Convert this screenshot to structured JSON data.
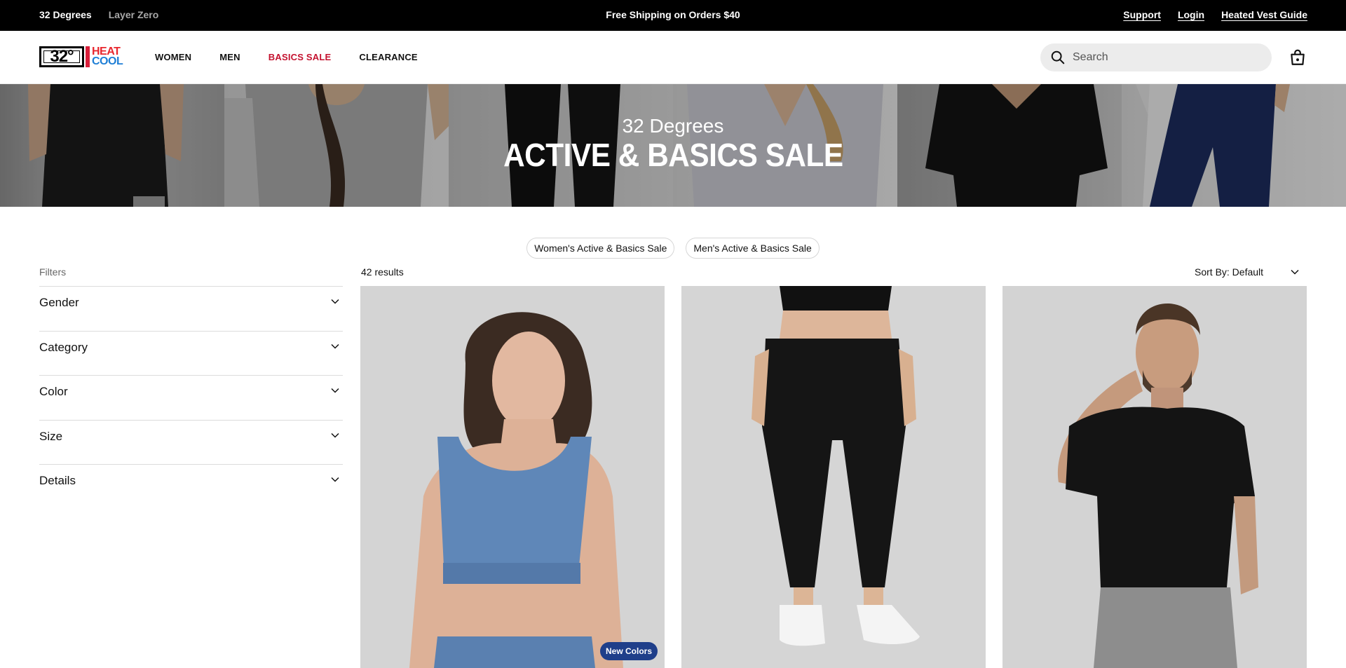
{
  "topbar": {
    "brands": [
      "32 Degrees",
      "Layer Zero"
    ],
    "promo": "Free Shipping on Orders $40",
    "links": [
      "Support",
      "Login",
      "Heated Vest Guide"
    ]
  },
  "header": {
    "logo": {
      "number": "32°",
      "heat": "HEAT",
      "cool": "COOL"
    },
    "nav": [
      "WOMEN",
      "MEN",
      "BASICS SALE",
      "CLEARANCE"
    ],
    "search_placeholder": "Search",
    "colors": {
      "sale_link": "#c4122f",
      "heat": "#e8262d",
      "cool": "#1f7fd6"
    }
  },
  "hero": {
    "eyebrow": "32 Degrees",
    "headline": "ACTIVE & BASICS SALE"
  },
  "pills": [
    "Women's Active & Basics Sale",
    "Men's Active & Basics Sale"
  ],
  "filters": {
    "title": "Filters",
    "groups": [
      "Gender",
      "Category",
      "Color",
      "Size",
      "Details"
    ]
  },
  "results": {
    "count": "42 results",
    "sort": "Sort By: Default"
  },
  "products": [
    {
      "image": "woman-blue-sports-bra",
      "badge": "New Colors"
    },
    {
      "image": "black-leggings-white-sneakers"
    },
    {
      "image": "man-black-tshirt-gray-shorts"
    }
  ]
}
